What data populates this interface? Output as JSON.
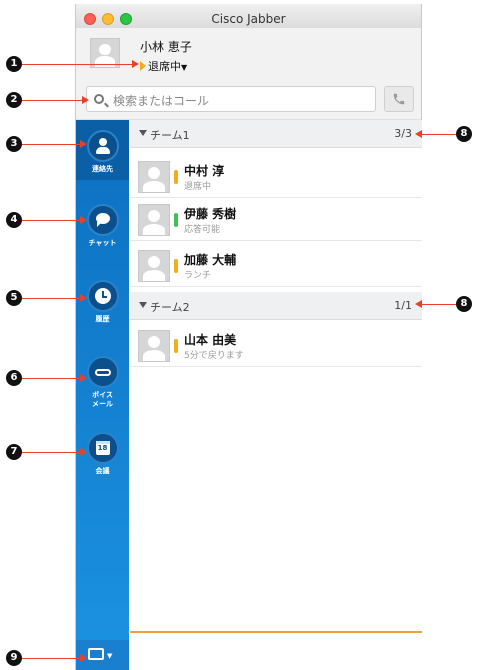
{
  "window": {
    "title": "Cisco Jabber"
  },
  "user": {
    "name": "小林 恵子",
    "status": "退席中"
  },
  "search": {
    "placeholder": "検索またはコール"
  },
  "sidebar": {
    "items": [
      {
        "label": "連絡先",
        "icon": "contacts-icon",
        "active": true
      },
      {
        "label": "チャット",
        "icon": "chat-icon",
        "active": false
      },
      {
        "label": "履歴",
        "icon": "clock-icon",
        "active": false
      },
      {
        "label": "ボイス\nメール",
        "icon": "voicemail-icon",
        "active": false
      },
      {
        "label": "会議",
        "icon": "calendar-icon",
        "active": false,
        "calendar_day": "18"
      }
    ],
    "bottom_icon": "screen-share-icon"
  },
  "groups": [
    {
      "name": "チーム1",
      "count": "3/3",
      "contacts": [
        {
          "name": "中村 淳",
          "status": "退席中",
          "presence": "away"
        },
        {
          "name": "伊藤 秀樹",
          "status": "応答可能",
          "presence": "available"
        },
        {
          "name": "加藤 大輔",
          "status": "ランチ",
          "presence": "away"
        }
      ]
    },
    {
      "name": "チーム2",
      "count": "1/1",
      "contacts": [
        {
          "name": "山本 由美",
          "status": "5分で戻ります",
          "presence": "away"
        }
      ]
    }
  ],
  "callouts": [
    "1",
    "2",
    "3",
    "4",
    "5",
    "6",
    "7",
    "8",
    "8",
    "9"
  ],
  "colors": {
    "accent_blue": "#0d6fc0",
    "away": "#f0ad1e",
    "available": "#3dc458",
    "callout_line": "#e8412a"
  }
}
